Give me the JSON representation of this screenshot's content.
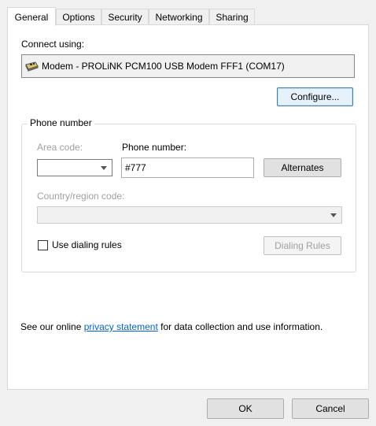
{
  "tabs": [
    {
      "label": "General",
      "active": true
    },
    {
      "label": "Options",
      "active": false
    },
    {
      "label": "Security",
      "active": false
    },
    {
      "label": "Networking",
      "active": false
    },
    {
      "label": "Sharing",
      "active": false
    }
  ],
  "general": {
    "connect_using_label": "Connect using:",
    "modem_name": "Modem - PROLiNK PCM100 USB Modem FFF1 (COM17)",
    "modem_icon": "modem-icon",
    "configure_label": "Configure...",
    "phone_group_title": "Phone number",
    "area_code_label": "Area code:",
    "area_code_value": "",
    "phone_number_label": "Phone number:",
    "phone_number_value": "#777",
    "alternates_label": "Alternates",
    "country_label": "Country/region code:",
    "country_value": "",
    "use_dialing_rules_label": "Use dialing rules",
    "use_dialing_rules_checked": false,
    "dialing_rules_label": "Dialing Rules",
    "privacy_prefix": "See our online ",
    "privacy_link": "privacy statement",
    "privacy_suffix": " for data collection and use information."
  },
  "footer": {
    "ok_label": "OK",
    "cancel_label": "Cancel"
  }
}
